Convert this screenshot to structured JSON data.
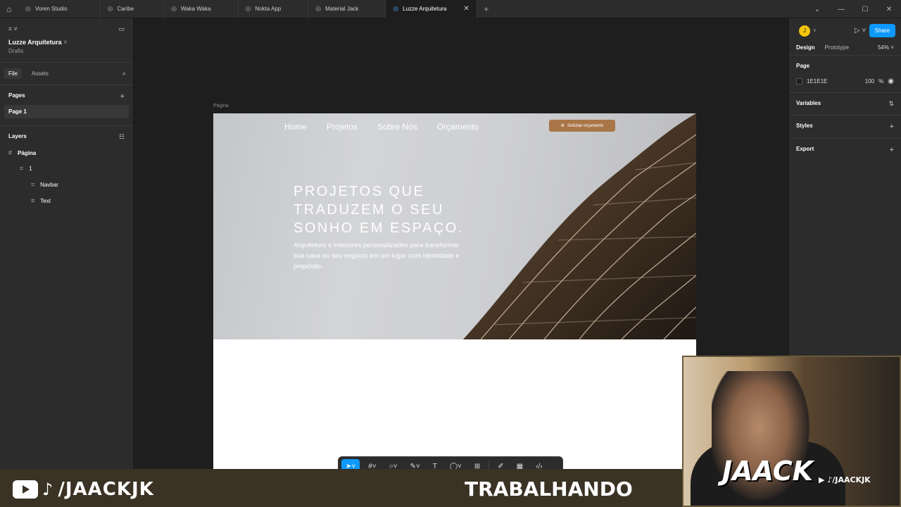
{
  "tabs": [
    {
      "label": "Voren Studio"
    },
    {
      "label": "Caribe"
    },
    {
      "label": "Waka Waka"
    },
    {
      "label": "Nokta App"
    },
    {
      "label": "Material Jack"
    },
    {
      "label": "Luzze Arquitetura",
      "active": true
    }
  ],
  "left_panel": {
    "project_name": "Luzze Arquitetura",
    "project_location": "Drafts",
    "file_tab": "File",
    "assets_tab": "Assets",
    "pages_title": "Pages",
    "page_item": "Page 1",
    "layers_title": "Layers",
    "layers": [
      {
        "label": "Página",
        "icon": "frame-icon"
      },
      {
        "label": "1",
        "icon": "frame-icon"
      },
      {
        "label": "Navbar",
        "icon": "frame-icon"
      },
      {
        "label": "Text",
        "icon": "text-icon"
      }
    ]
  },
  "right_panel": {
    "avatar": "J",
    "share": "Share",
    "design_tab": "Design",
    "prototype_tab": "Prototype",
    "zoom": "54%",
    "page_title": "Page",
    "page_color": "1E1E1E",
    "page_opacity": "100",
    "page_opacity_unit": "%",
    "variables": "Variables",
    "styles": "Styles",
    "export": "Export"
  },
  "canvas": {
    "frame_label": "Página",
    "nav": [
      "Home",
      "Projetos",
      "Sobre Nós",
      "Orçamento"
    ],
    "cta": "Solicitar orçamento",
    "headline": "PROJETOS QUE TRADUZEM O SEU SONHO EM ESPAÇO.",
    "subtitle": "Arquitetura e interiores personalizados para transformar sua casa ou seu negócio em um lugar com identidade e propósito."
  },
  "overlay": {
    "handle_left": "/JAACKJK",
    "status": "TRABALHANDO",
    "cam_logo": "JAACK",
    "cam_handle": "/JAACKJK"
  },
  "colors": {
    "accent": "#0d99ff",
    "cta": "#a97649",
    "canvas_bg": "#1e1e1e"
  }
}
